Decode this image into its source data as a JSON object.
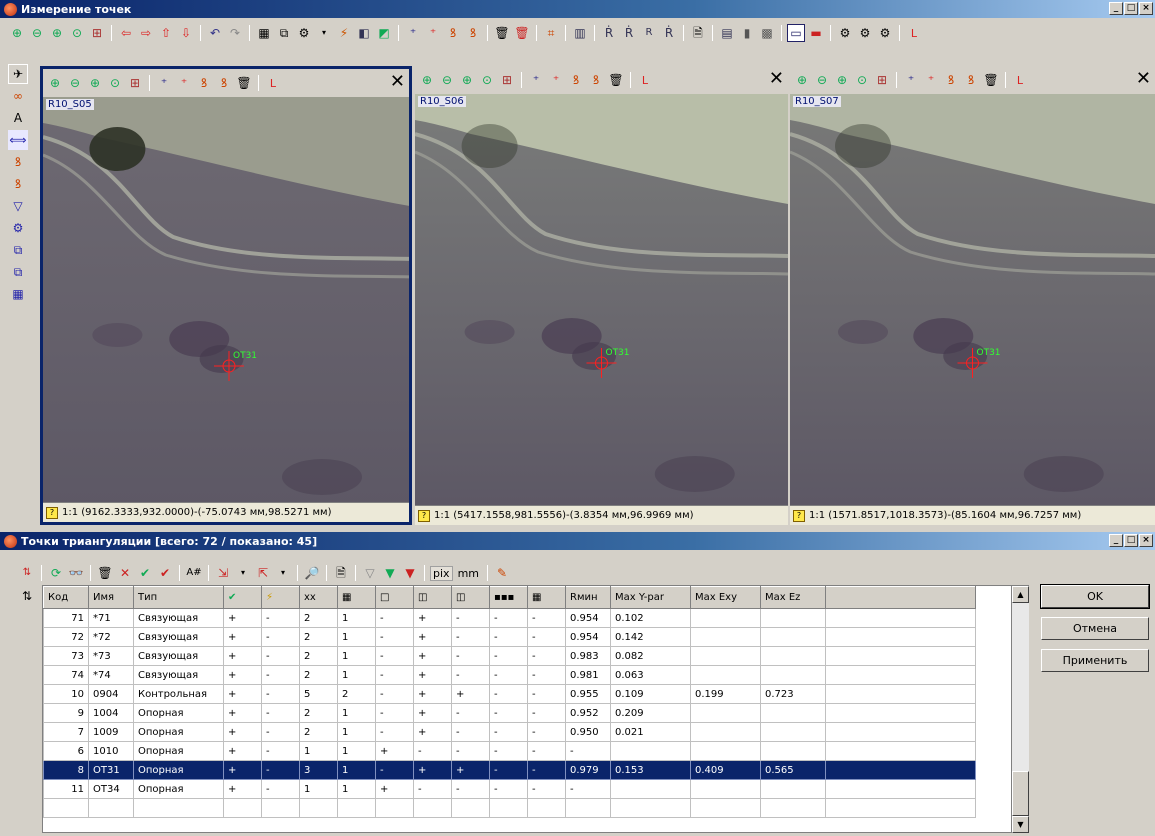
{
  "main_window": {
    "title": "Измерение точек"
  },
  "icons": {
    "zoom_in": "🔍",
    "zoom_out": "🔍",
    "arrow_left": "⇦",
    "arrow_right": "⇨",
    "arrow_up": "⇧",
    "arrow_down": "⇩",
    "undo": "↶",
    "redo": "↷",
    "close": "✕",
    "add_point": "+",
    "check": "✔",
    "cross": "✕",
    "pin": "⊕",
    "binoculars": "👓",
    "trash": "🗑",
    "doc": "🗎",
    "filter": "▽",
    "grid": "▦",
    "refresh": "⟳",
    "letter_l": "L",
    "letter_r": "R"
  },
  "panes": [
    {
      "image": "R10_S05",
      "status": "1:1 (9162.3333,932.0000)-(-75.0743 мм,98.5271 мм)",
      "marker": "OT31"
    },
    {
      "image": "R10_S06",
      "status": "1:1 (5417.1558,981.5556)-(3.8354 мм,96.9969 мм)",
      "marker": "OT31"
    },
    {
      "image": "R10_S07",
      "status": "1:1 (1571.8517,1018.3573)-(85.1604 мм,96.7257 мм)",
      "marker": "OT31"
    }
  ],
  "points_window": {
    "title": "Точки триангуляции [всего: 72 / показано: 45]",
    "unit_pix": "pix",
    "unit_mm": "mm"
  },
  "table": {
    "headers": [
      "Код",
      "Имя",
      "Тип",
      "✔",
      "⚡",
      "xx",
      "▦",
      "□",
      "◫",
      "◫",
      "▪▪▪",
      "▦",
      "Rмин",
      "Max Y-par",
      "Max Exy",
      "Max Ez"
    ],
    "rows": [
      [
        "71",
        "*71",
        "Связующая",
        "+",
        "-",
        "2",
        "1",
        "-",
        "+",
        "-",
        "-",
        "-",
        "0.954",
        "0.102",
        "",
        ""
      ],
      [
        "72",
        "*72",
        "Связующая",
        "+",
        "-",
        "2",
        "1",
        "-",
        "+",
        "-",
        "-",
        "-",
        "0.954",
        "0.142",
        "",
        ""
      ],
      [
        "73",
        "*73",
        "Связующая",
        "+",
        "-",
        "2",
        "1",
        "-",
        "+",
        "-",
        "-",
        "-",
        "0.983",
        "0.082",
        "",
        ""
      ],
      [
        "74",
        "*74",
        "Связующая",
        "+",
        "-",
        "2",
        "1",
        "-",
        "+",
        "-",
        "-",
        "-",
        "0.981",
        "0.063",
        "",
        ""
      ],
      [
        "10",
        "0904",
        "Контрольная",
        "+",
        "-",
        "5",
        "2",
        "-",
        "+",
        "+",
        "-",
        "-",
        "0.955",
        "0.109",
        "0.199",
        "0.723"
      ],
      [
        "9",
        "1004",
        "Опорная",
        "+",
        "-",
        "2",
        "1",
        "-",
        "+",
        "-",
        "-",
        "-",
        "0.952",
        "0.209",
        "",
        ""
      ],
      [
        "7",
        "1009",
        "Опорная",
        "+",
        "-",
        "2",
        "1",
        "-",
        "+",
        "-",
        "-",
        "-",
        "0.950",
        "0.021",
        "",
        ""
      ],
      [
        "6",
        "1010",
        "Опорная",
        "+",
        "-",
        "1",
        "1",
        "+",
        "-",
        "-",
        "-",
        "-",
        "-",
        "",
        "",
        ""
      ],
      [
        "8",
        "OT31",
        "Опорная",
        "+",
        "-",
        "3",
        "1",
        "-",
        "+",
        "+",
        "-",
        "-",
        "0.979",
        "0.153",
        "0.409",
        "0.565"
      ],
      [
        "11",
        "OT34",
        "Опорная",
        "+",
        "-",
        "1",
        "1",
        "+",
        "-",
        "-",
        "-",
        "-",
        "-",
        "",
        "",
        ""
      ],
      [
        "",
        "",
        "",
        "",
        "",
        "",
        "",
        "",
        "",
        "",
        "",
        "",
        "",
        "",
        "",
        ""
      ]
    ],
    "selected_row": 8
  },
  "buttons": {
    "ok": "OK",
    "cancel": "Отмена",
    "apply": "Применить"
  },
  "colors": {
    "title_active": "#0a246a",
    "selection": "#0a246a",
    "marker_red": "#ff2020",
    "marker_green": "#20ff20"
  }
}
